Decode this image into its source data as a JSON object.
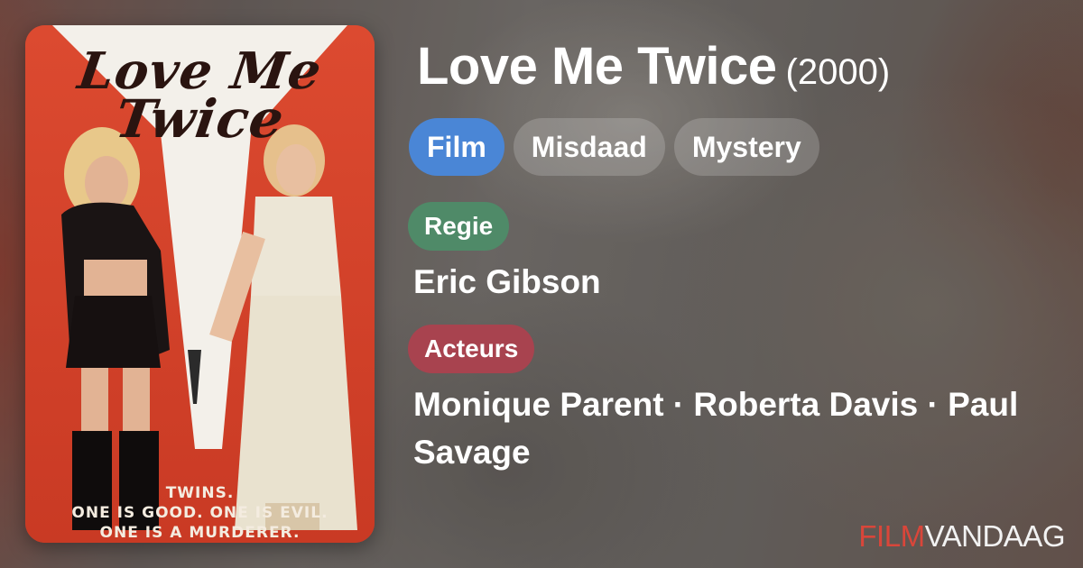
{
  "poster": {
    "title_line1": "Love Me",
    "title_line2": "Twice",
    "tagline_line1": "TWINS.",
    "tagline_line2": "ONE IS GOOD. ONE IS EVIL.",
    "tagline_line3": "ONE IS A MURDERER."
  },
  "movie": {
    "title": "Love Me Twice",
    "year": "(2000)"
  },
  "genres": [
    "Film",
    "Misdaad",
    "Mystery"
  ],
  "director": {
    "label": "Regie",
    "value": "Eric Gibson"
  },
  "cast": {
    "label": "Acteurs",
    "value": "Monique Parent · Roberta Davis · Paul Savage"
  },
  "brand": {
    "part1": "FILM",
    "part2": "VANDAAG"
  },
  "colors": {
    "genre_primary": "#4a86d6",
    "regie_badge": "#4f8a68",
    "acteurs_badge": "#a8434f",
    "brand_accent": "#d9463a"
  }
}
